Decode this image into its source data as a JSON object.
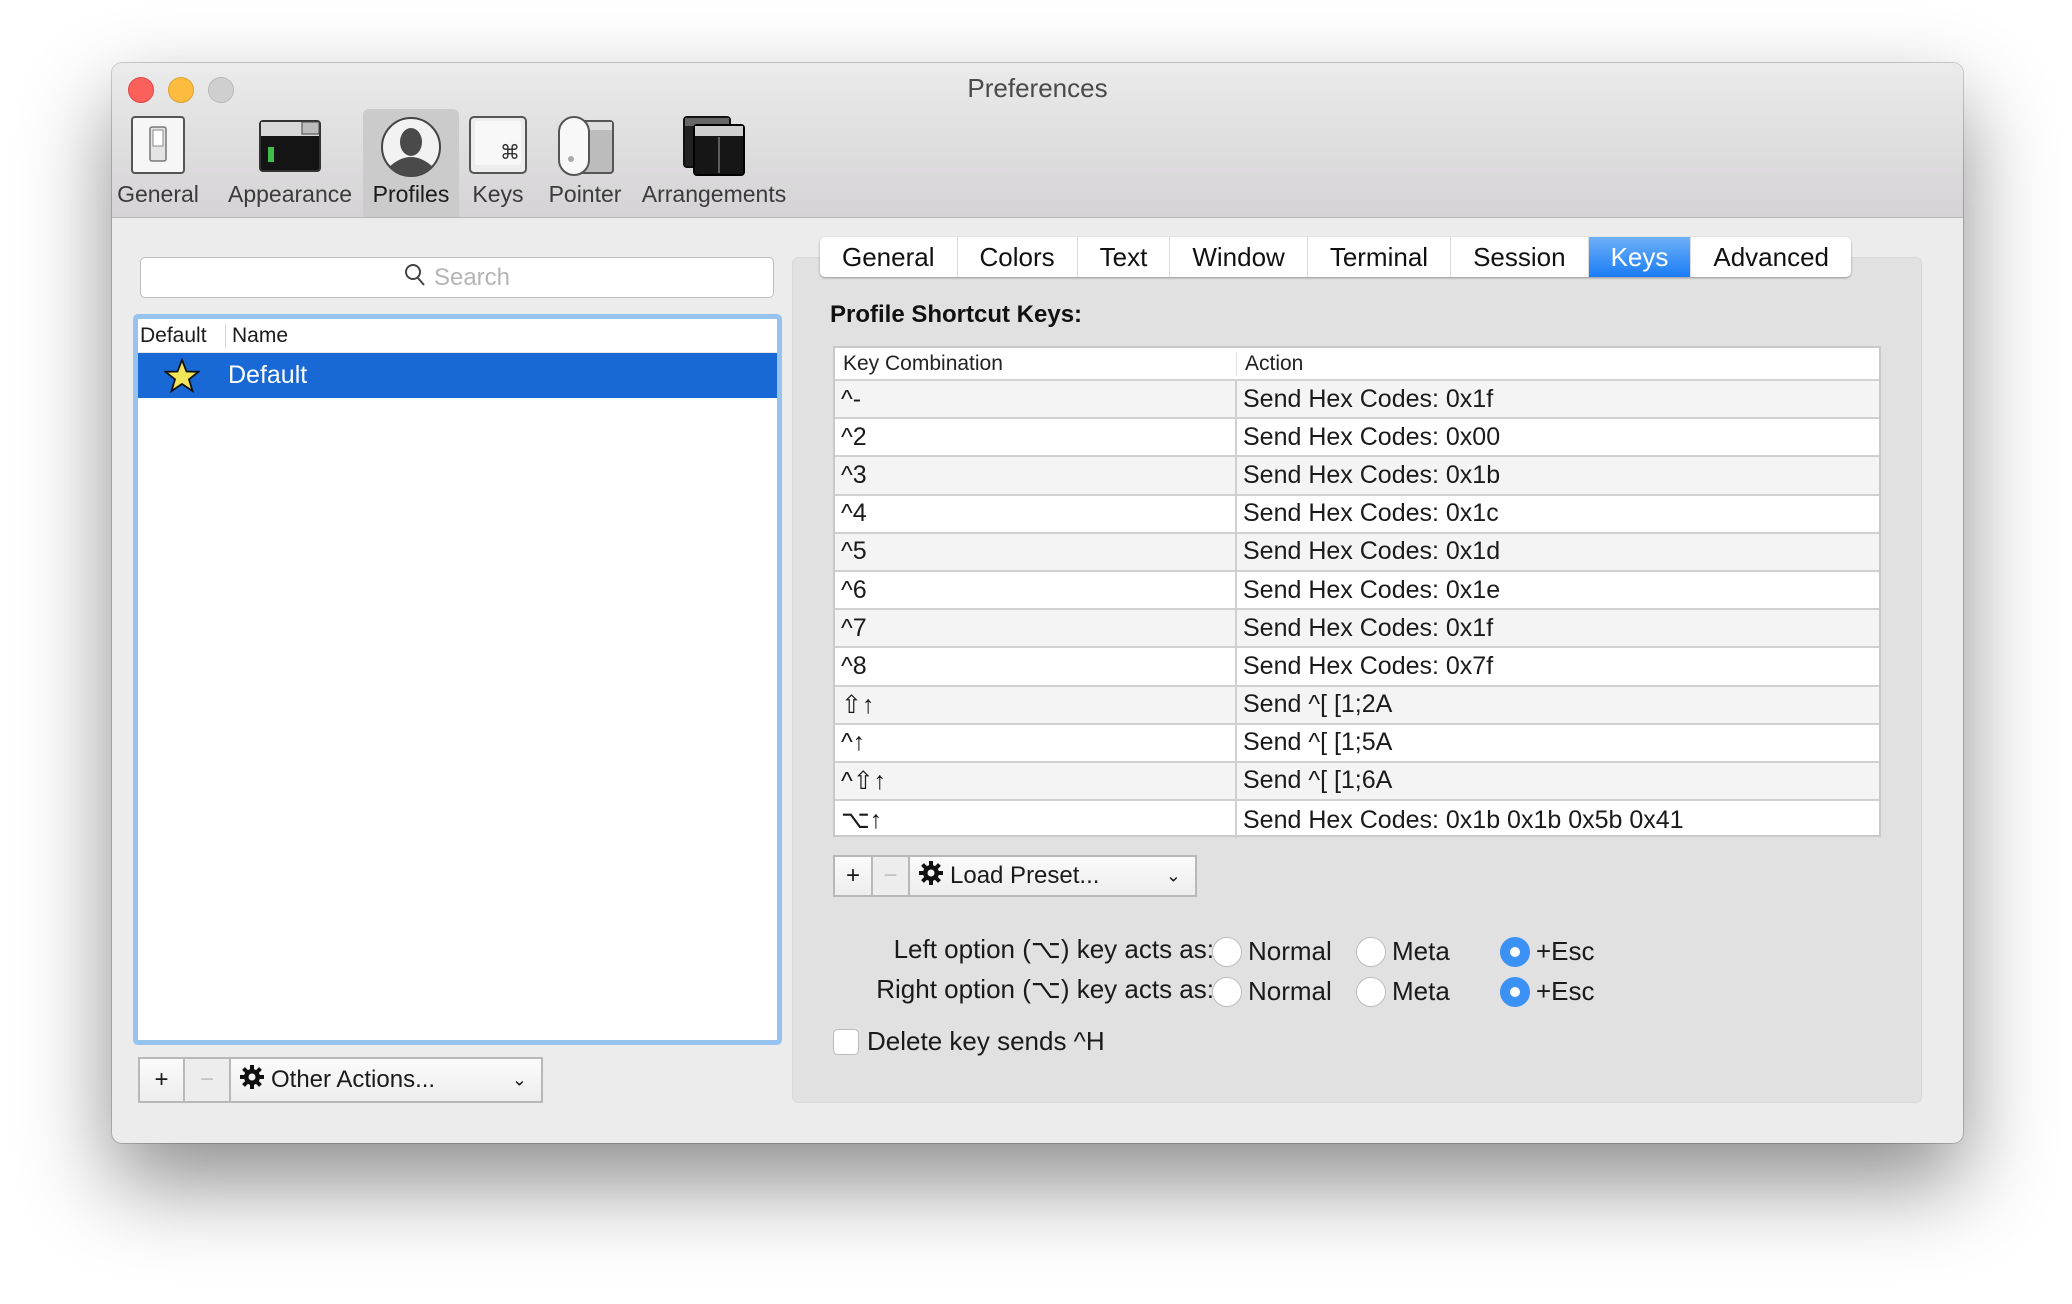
{
  "window": {
    "title": "Preferences"
  },
  "toolbar": {
    "items": [
      {
        "label": "General",
        "icon": "light-switch-icon",
        "selected": false
      },
      {
        "label": "Appearance",
        "icon": "terminal-window-icon",
        "selected": false
      },
      {
        "label": "Profiles",
        "icon": "user-silhouette-icon",
        "selected": true
      },
      {
        "label": "Keys",
        "icon": "command-key-icon",
        "selected": false
      },
      {
        "label": "Pointer",
        "icon": "mouse-icon",
        "selected": false
      },
      {
        "label": "Arrangements",
        "icon": "window-arrangement-icon",
        "selected": false
      }
    ]
  },
  "profiles": {
    "search_placeholder": "Search",
    "columns": {
      "default": "Default",
      "name": "Name"
    },
    "rows": [
      {
        "is_default": true,
        "name": "Default",
        "selected": true
      }
    ],
    "add_label": "+",
    "remove_label": "−",
    "other_actions_label": "Other Actions..."
  },
  "profile_tabs": {
    "items": [
      "General",
      "Colors",
      "Text",
      "Window",
      "Terminal",
      "Session",
      "Keys",
      "Advanced"
    ],
    "active": "Keys"
  },
  "keys_panel": {
    "section_title": "Profile Shortcut Keys:",
    "table": {
      "columns": [
        "Key Combination",
        "Action"
      ],
      "rows": [
        {
          "key": "^-",
          "action": "Send Hex Codes: 0x1f"
        },
        {
          "key": "^2",
          "action": "Send Hex Codes: 0x00"
        },
        {
          "key": "^3",
          "action": "Send Hex Codes: 0x1b"
        },
        {
          "key": "^4",
          "action": "Send Hex Codes: 0x1c"
        },
        {
          "key": "^5",
          "action": "Send Hex Codes: 0x1d"
        },
        {
          "key": "^6",
          "action": "Send Hex Codes: 0x1e"
        },
        {
          "key": "^7",
          "action": "Send Hex Codes: 0x1f"
        },
        {
          "key": "^8",
          "action": "Send Hex Codes: 0x7f"
        },
        {
          "key": "⇧↑",
          "action": "Send ^[ [1;2A"
        },
        {
          "key": "^↑",
          "action": "Send ^[ [1;5A"
        },
        {
          "key": "^⇧↑",
          "action": "Send ^[ [1;6A"
        },
        {
          "key": "⌥↑",
          "action": "Send Hex Codes: 0x1b 0x1b 0x5b 0x41"
        }
      ]
    },
    "add_label": "+",
    "remove_label": "−",
    "load_preset_label": "Load Preset...",
    "left_option": {
      "label": "Left option (⌥) key acts as:",
      "options": [
        "Normal",
        "Meta",
        "+Esc"
      ],
      "selected": "+Esc"
    },
    "right_option": {
      "label": "Right option (⌥) key acts as:",
      "options": [
        "Normal",
        "Meta",
        "+Esc"
      ],
      "selected": "+Esc"
    },
    "delete_sends_ctrl_h": {
      "label": "Delete key sends ^H",
      "checked": false
    }
  },
  "colors": {
    "accent": "#1a7cf5",
    "selection": "#1869d6",
    "focus_ring": "#97c3f0",
    "radio_on": "#3c92f4",
    "close": "#fc605b",
    "minimize": "#fdbc40",
    "zoom": "#cfcfcf"
  }
}
